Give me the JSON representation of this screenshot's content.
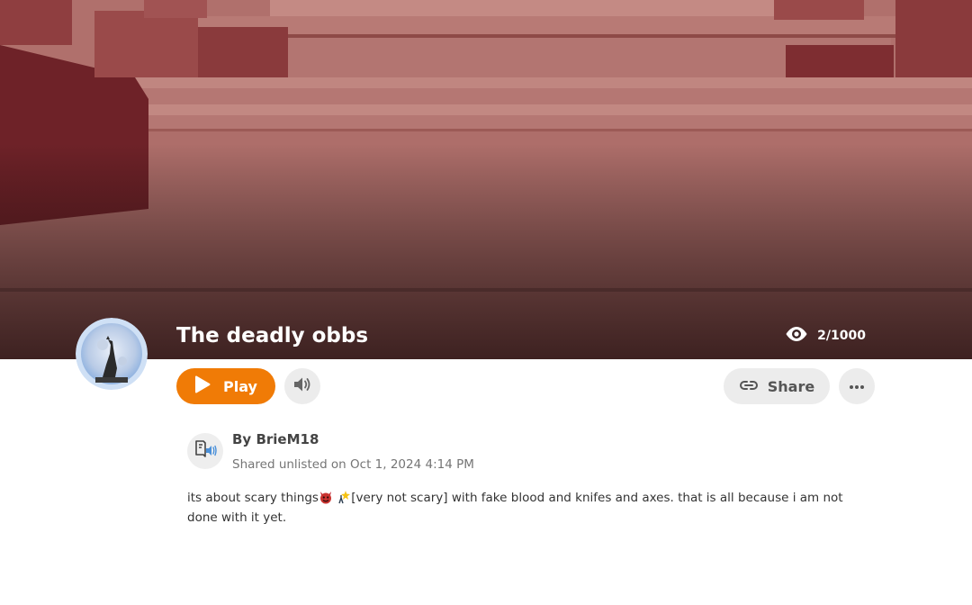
{
  "project": {
    "title": "The deadly obbs",
    "views": "2/1000",
    "author_prefix": "By ",
    "author": "BrieM18",
    "shared_info": "Shared unlisted on Oct 1, 2024 4:14 PM",
    "description_part1": "its about scary things",
    "description_emojis": [
      "devil-face",
      "sparkle-figure"
    ],
    "description_part2": "[very not scary]  with fake blood and knifes and axes. that is all because i am not done with it yet."
  },
  "actions": {
    "play_label": "Play",
    "share_label": "Share"
  },
  "colors": {
    "play_button": "#f07b06",
    "hero_red": "#b46e6a",
    "button_gray": "#ececec"
  },
  "icons": {
    "play": "play-icon",
    "sound": "speaker-icon",
    "share": "link-icon",
    "more": "more-dots-icon",
    "views": "eye-icon",
    "author": "book-audio-icon"
  }
}
